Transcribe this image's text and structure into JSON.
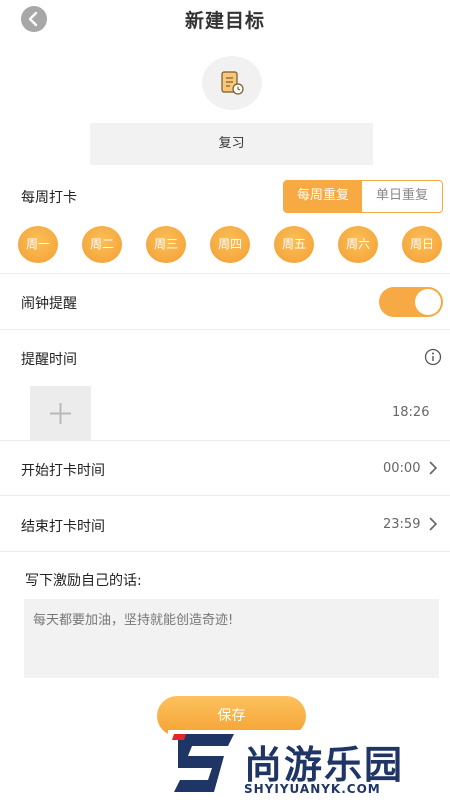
{
  "header": {
    "title": "新建目标",
    "back_icon": "chevron-left-icon"
  },
  "goal": {
    "icon": "notebook-clock-icon",
    "name": "复习"
  },
  "weekly": {
    "label": "每周打卡",
    "modes": [
      "每周重复",
      "单日重复"
    ],
    "selected_mode": "每周重复",
    "days": [
      "周一",
      "周二",
      "周三",
      "周四",
      "周五",
      "周六",
      "周日"
    ]
  },
  "alarm": {
    "label": "闹钟提醒",
    "enabled": true
  },
  "reminder": {
    "label": "提醒时间",
    "info_icon": "info-icon",
    "add_icon": "plus-icon",
    "time": "18:26"
  },
  "start": {
    "label": "开始打卡时间",
    "value": "00:00"
  },
  "end": {
    "label": "结束打卡时间",
    "value": "23:59"
  },
  "motto": {
    "label": "写下激励自己的话:",
    "placeholder": "每天都要加油，坚持就能创造奇迹!"
  },
  "save_label": "保存",
  "watermark": {
    "text": "尚游乐园",
    "url": "SHYIYUANYK.COM"
  },
  "colors": {
    "accent": "#f7a943",
    "navy": "#1f3566",
    "red": "#e3262b"
  }
}
